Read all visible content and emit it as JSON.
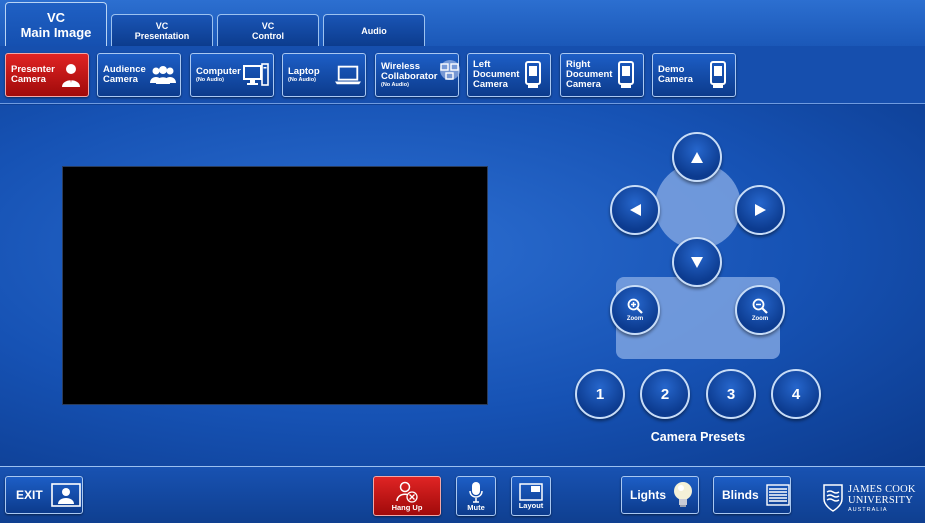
{
  "tabs": [
    {
      "line1": "VC",
      "line2": "Main Image",
      "active": true
    },
    {
      "line1": "VC",
      "line2": "Presentation",
      "active": false
    },
    {
      "line1": "VC",
      "line2": "Control",
      "active": false
    },
    {
      "line1": "Audio",
      "line2": "",
      "active": false
    }
  ],
  "sources": [
    {
      "label": "Presenter Camera",
      "sub": "",
      "icon": "presenter-icon",
      "active": true
    },
    {
      "label": "Audience Camera",
      "sub": "",
      "icon": "audience-icon",
      "active": false
    },
    {
      "label": "Computer",
      "sub": "(No Audio)",
      "icon": "computer-icon",
      "active": false
    },
    {
      "label": "Laptop",
      "sub": "(No Audio)",
      "icon": "laptop-icon",
      "active": false
    },
    {
      "label": "Wireless Collaborator",
      "sub": "(No Audio)",
      "icon": "wireless-icon",
      "active": false
    },
    {
      "label": "Left Document Camera",
      "sub": "",
      "icon": "document-camera-icon",
      "active": false
    },
    {
      "label": "Right Document Camera",
      "sub": "",
      "icon": "document-camera-icon",
      "active": false
    },
    {
      "label": "Demo Camera",
      "sub": "",
      "icon": "document-camera-icon",
      "active": false
    }
  ],
  "ptz": {
    "zoom_in_label": "Zoom",
    "zoom_out_label": "Zoom"
  },
  "presets": {
    "label": "Camera Presets",
    "items": [
      "1",
      "2",
      "3",
      "4"
    ]
  },
  "bottom": {
    "exit": "EXIT",
    "hang_up": "Hang Up",
    "mute": "Mute",
    "layout": "Layout",
    "lights": "Lights",
    "blinds": "Blinds"
  },
  "logo": {
    "line1": "JAMES COOK",
    "line2": "UNIVERSITY",
    "line3": "AUSTRALIA"
  },
  "colors": {
    "accent": "#1652b4",
    "active": "#d41c1c",
    "border": "#a9c8f2"
  }
}
